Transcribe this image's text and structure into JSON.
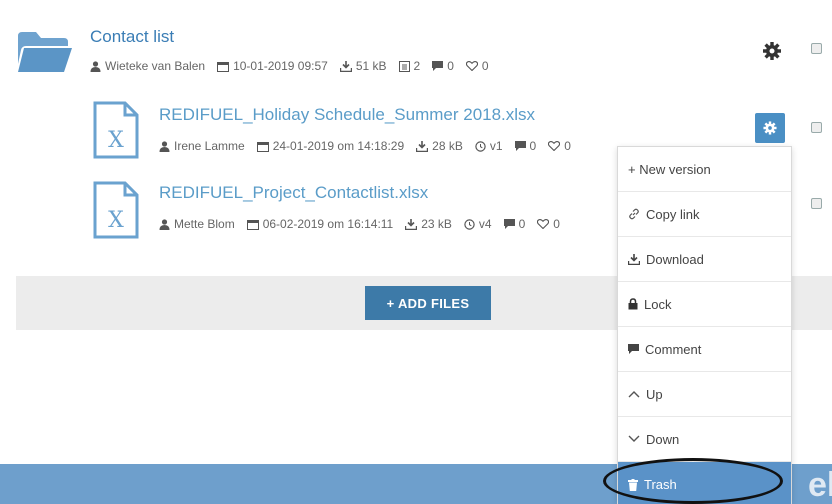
{
  "folder": {
    "title": "Contact list",
    "author": "Wieteke van Balen",
    "date": "10-01-2019 09:57",
    "size": "51 kB",
    "files": "2",
    "comments": "0",
    "likes": "0"
  },
  "files": [
    {
      "title": "REDIFUEL_Holiday Schedule_Summer 2018.xlsx",
      "author": "Irene Lamme",
      "date": "24-01-2019 om 14:18:29",
      "size": "28 kB",
      "version": "v1",
      "comments": "0",
      "likes": "0"
    },
    {
      "title": "REDIFUEL_Project_Contactlist.xlsx",
      "author": "Mette Blom",
      "date": "06-02-2019 om 16:14:11",
      "size": "23 kB",
      "version": "v4",
      "comments": "0",
      "likes": "0"
    }
  ],
  "add_files_label": "+ ADD FILES",
  "menu": {
    "new_version": "+ New version",
    "copy_link": "Copy link",
    "download": "Download",
    "lock": "Lock",
    "comment": "Comment",
    "up": "Up",
    "down": "Down",
    "trash": "Trash"
  },
  "bottom_text": "el",
  "colors": {
    "accent": "#4a8fc4",
    "title_link": "#5a9cc8",
    "band": "#6e9fcc"
  }
}
